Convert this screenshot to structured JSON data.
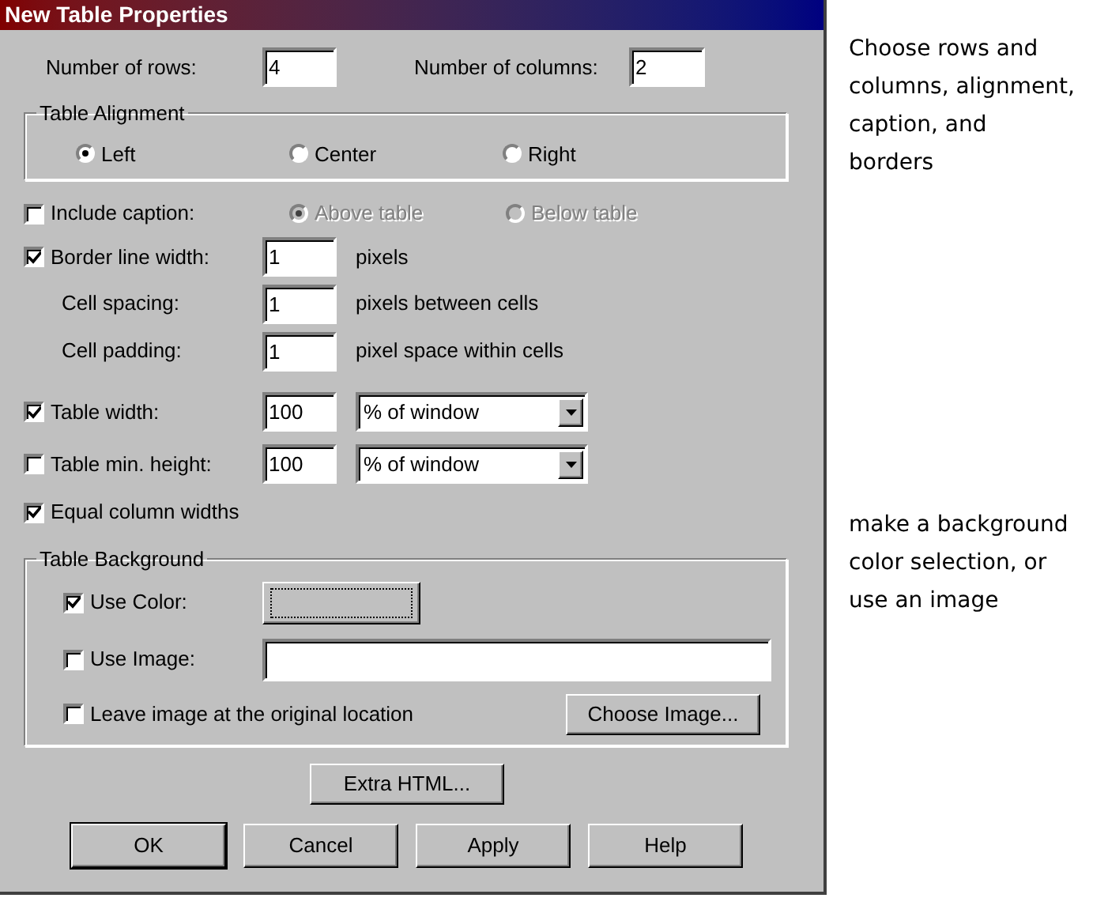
{
  "window": {
    "title": "New Table Properties"
  },
  "rows_field": {
    "label": "Number of rows:",
    "value": "4"
  },
  "columns_field": {
    "label": "Number of columns:",
    "value": "2"
  },
  "alignment": {
    "legend": "Table Alignment",
    "options": [
      {
        "label": "Left",
        "selected": true
      },
      {
        "label": "Center",
        "selected": false
      },
      {
        "label": "Right",
        "selected": false
      }
    ]
  },
  "caption": {
    "label": "Include caption:",
    "checked": false,
    "options": [
      {
        "label": "Above table",
        "selected": true,
        "disabled": true
      },
      {
        "label": "Below table",
        "selected": false,
        "disabled": true
      }
    ]
  },
  "border": {
    "label": "Border line width:",
    "checked": true,
    "value": "1",
    "unit": "pixels"
  },
  "spacing": {
    "label": "Cell spacing:",
    "value": "1",
    "unit": "pixels between cells"
  },
  "padding": {
    "label": "Cell padding:",
    "value": "1",
    "unit": "pixel space within cells"
  },
  "table_width": {
    "label": "Table width:",
    "checked": true,
    "value": "100",
    "unit": "% of window"
  },
  "min_height": {
    "label": "Table min. height:",
    "checked": false,
    "value": "100",
    "unit": "% of window"
  },
  "equal_widths": {
    "label": "Equal column widths",
    "checked": true
  },
  "background": {
    "legend": "Table Background",
    "use_color": {
      "label": "Use Color:",
      "checked": true
    },
    "use_image": {
      "label": "Use Image:",
      "checked": false
    },
    "leave_image": {
      "label": "Leave image at the original location",
      "checked": false
    },
    "choose_button": "Choose Image..."
  },
  "extra_button": "Extra HTML...",
  "buttons": [
    "OK",
    "Cancel",
    "Apply",
    "Help"
  ],
  "notes": [
    {
      "lines": [
        "Choose rows and",
        "columns, alignment,",
        "caption, and",
        "borders"
      ]
    },
    {
      "lines": [
        "make a background",
        "color selection, or",
        "use an image"
      ]
    }
  ]
}
